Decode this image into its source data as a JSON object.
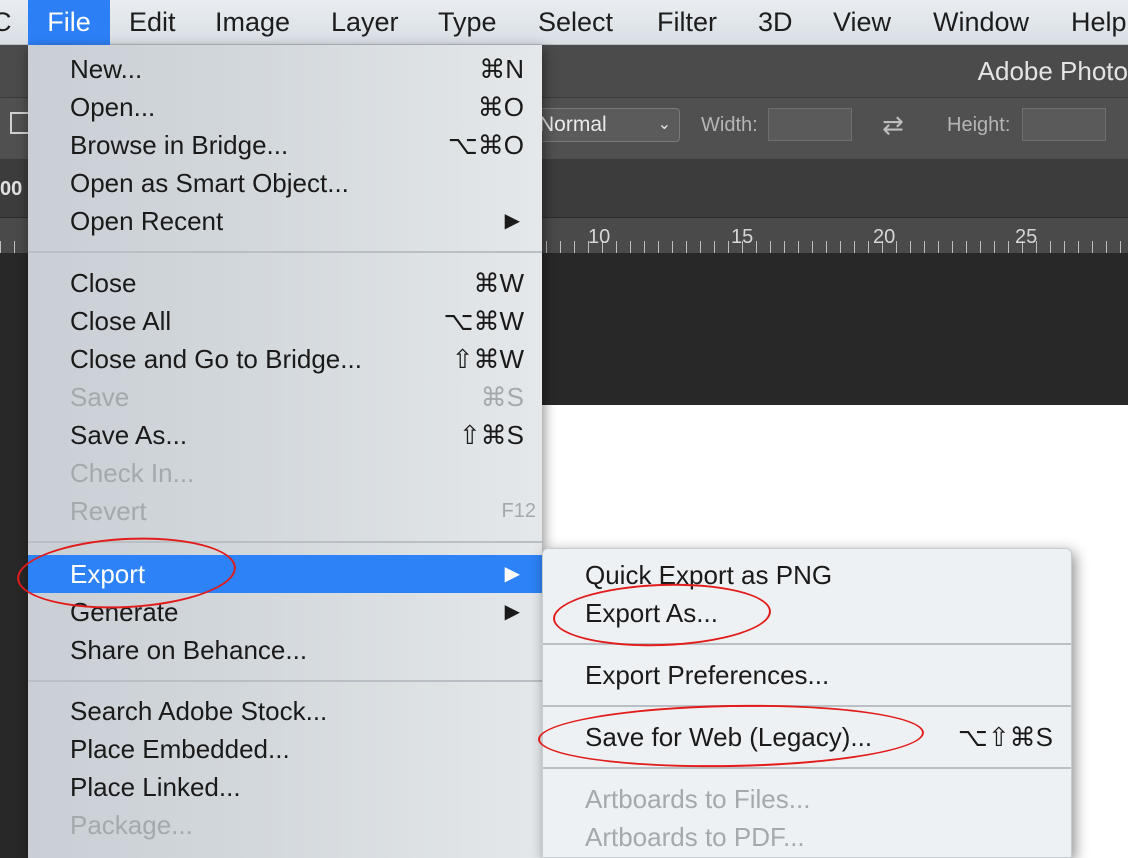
{
  "menubar": {
    "items": [
      "C",
      "File",
      "Edit",
      "Image",
      "Layer",
      "Type",
      "Select",
      "Filter",
      "3D",
      "View",
      "Window",
      "Help"
    ]
  },
  "app": {
    "title": "Adobe Photo",
    "zoom_fragment": "00",
    "options": {
      "blend_mode": "Normal",
      "width_label": "Width:",
      "height_label": "Height:"
    },
    "ruler": [
      "10",
      "15",
      "20",
      "25"
    ]
  },
  "file_menu": {
    "groups": [
      [
        {
          "label": "New...",
          "shortcut": "⌘N",
          "enabled": true
        },
        {
          "label": "Open...",
          "shortcut": "⌘O",
          "enabled": true
        },
        {
          "label": "Browse in Bridge...",
          "shortcut": "⌥⌘O",
          "enabled": true
        },
        {
          "label": "Open as Smart Object...",
          "shortcut": "",
          "enabled": true
        },
        {
          "label": "Open Recent",
          "shortcut": "",
          "submenu": true,
          "enabled": true
        }
      ],
      [
        {
          "label": "Close",
          "shortcut": "⌘W",
          "enabled": true
        },
        {
          "label": "Close All",
          "shortcut": "⌥⌘W",
          "enabled": true
        },
        {
          "label": "Close and Go to Bridge...",
          "shortcut": "⇧⌘W",
          "enabled": true
        },
        {
          "label": "Save",
          "shortcut": "⌘S",
          "enabled": false
        },
        {
          "label": "Save As...",
          "shortcut": "⇧⌘S",
          "enabled": true
        },
        {
          "label": "Check In...",
          "shortcut": "",
          "enabled": false
        },
        {
          "label": "Revert",
          "shortcut": "F12",
          "enabled": false
        }
      ],
      [
        {
          "label": "Export",
          "shortcut": "",
          "submenu": true,
          "enabled": true,
          "selected": true
        },
        {
          "label": "Generate",
          "shortcut": "",
          "submenu": true,
          "enabled": true
        },
        {
          "label": "Share on Behance...",
          "shortcut": "",
          "enabled": true
        }
      ],
      [
        {
          "label": "Search Adobe Stock...",
          "shortcut": "",
          "enabled": true
        },
        {
          "label": "Place Embedded...",
          "shortcut": "",
          "enabled": true
        },
        {
          "label": "Place Linked...",
          "shortcut": "",
          "enabled": true
        },
        {
          "label": "Package...",
          "shortcut": "",
          "enabled": false
        }
      ]
    ]
  },
  "export_submenu": {
    "groups": [
      [
        {
          "label": "Quick Export as PNG",
          "shortcut": "",
          "enabled": true
        },
        {
          "label": "Export As...",
          "shortcut": "",
          "enabled": true
        }
      ],
      [
        {
          "label": "Export Preferences...",
          "shortcut": "",
          "enabled": true
        }
      ],
      [
        {
          "label": "Save for Web (Legacy)...",
          "shortcut": "⌥⇧⌘S",
          "enabled": true
        }
      ],
      [
        {
          "label": "Artboards to Files...",
          "shortcut": "",
          "enabled": false
        },
        {
          "label": "Artboards to PDF...",
          "shortcut": "",
          "enabled": false
        }
      ]
    ]
  },
  "colors": {
    "highlight": "#2d82f7",
    "annotation": "#e21b1b"
  }
}
